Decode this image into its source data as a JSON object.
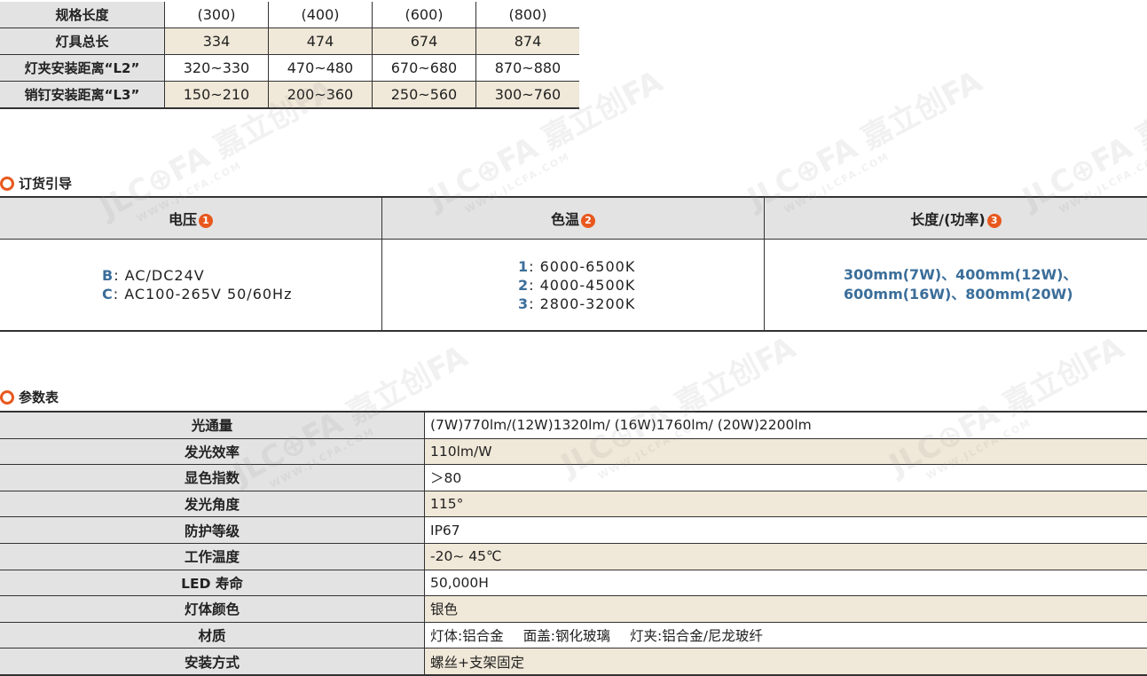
{
  "spec_table": {
    "rows": [
      {
        "label": "规格长度",
        "values": [
          "(300)",
          "(400)",
          "(600)",
          "(800)"
        ]
      },
      {
        "label": "灯具总长",
        "values": [
          "334",
          "474",
          "674",
          "874"
        ]
      },
      {
        "label": "灯夹安装距离“L2”",
        "values": [
          "320~330",
          "470~480",
          "670~680",
          "870~880"
        ]
      },
      {
        "label": "销钉安装距离“L3”",
        "values": [
          "150~210",
          "200~360",
          "250~560",
          "300~760"
        ]
      }
    ]
  },
  "order_guide": {
    "title": "订货引导",
    "headers": [
      {
        "label": "电压",
        "num": "1"
      },
      {
        "label": "色温",
        "num": "2"
      },
      {
        "label": "长度/(功率)",
        "num": "3"
      }
    ],
    "voltage": [
      {
        "code": "B",
        "text": ": AC/DC24V"
      },
      {
        "code": "C",
        "text": ": AC100-265V 50/60Hz"
      }
    ],
    "color_temp": [
      {
        "code": "1",
        "text": ": 6000-6500K"
      },
      {
        "code": "2",
        "text": ": 4000-4500K"
      },
      {
        "code": "3",
        "text": ": 2800-3200K"
      }
    ],
    "length_power": [
      "300mm(7W)、400mm(12W)、",
      "600mm(16W)、800mm(20W)"
    ]
  },
  "params": {
    "title": "参数表",
    "rows": [
      {
        "k": "光通量",
        "v": "(7W)770lm/(12W)1320lm/ (16W)1760lm/ (20W)2200lm"
      },
      {
        "k": "发光效率",
        "v": "110lm/W"
      },
      {
        "k": "显色指数",
        "v": "＞80"
      },
      {
        "k": "发光角度",
        "v": "115°"
      },
      {
        "k": "防护等级",
        "v": "IP67"
      },
      {
        "k": "工作温度",
        "v": "-20~ 45℃"
      },
      {
        "k": "LED 寿命",
        "v": "50,000H"
      },
      {
        "k": "灯体颜色",
        "v": "银色"
      },
      {
        "k": "材质",
        "v": "",
        "parts": [
          "灯体:铝合金",
          "面盖:钢化玻璃",
          "灯夹:铝合金/尼龙玻纤"
        ]
      },
      {
        "k": "安装方式",
        "v": "螺丝+支架固定"
      }
    ]
  },
  "watermark": {
    "logo": "JLC⊕FA 嘉立创FA",
    "url": "WWW.JLCFA.COM"
  },
  "colors": {
    "accent": "#e8581e",
    "code_blue": "#3b6e9a",
    "tan_row": "#f0e8d8",
    "header_gray": "#e3e3e3"
  }
}
